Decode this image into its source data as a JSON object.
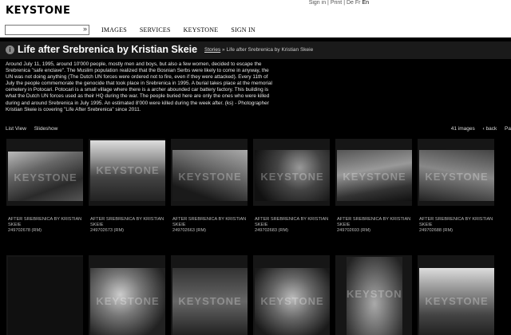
{
  "logo": "KEYSTONE",
  "toplinks": {
    "signin": "Sign in",
    "sep1": "|",
    "print": "Print",
    "sep2": "|",
    "de": "De",
    "fr": "Fr",
    "en": "En"
  },
  "search": {
    "placeholder": "",
    "go": "»"
  },
  "nav": [
    "IMAGES",
    "SERVICES",
    "KEYSTONE",
    "SIGN IN"
  ],
  "page_title": "Life after Srebrenica by Kristian Skeie",
  "breadcrumb": {
    "stories": "Stories",
    "rest": " » Life after Srebrenica by Kristian Skeie"
  },
  "description": "Around July 11, 1995, around 10'000 people, mostly men and boys, but also a few women, decided to escape the Srebrenica \"safe enclave\". The Muslim population realized that the Bosnian Serbs were likely to come in anyway, the UN was not doing anything (The Dutch UN forces were ordered not to fire, even if they were attacked). Every 11th of July the people commemorate the genocide that took place in Srebrenica in 1995. A burial takes place at the memorial cemetery in Potocari. Potocari is a small village where there is a archer abounded car battery factory. This building is what the Dutch UN forces used as their HQ during the war. The people buried here are only the ones who were killed during and around Srebrenica in July 1995. An estimated 8'000 were killed during the week after. (ks) - Photographer Kristian Skeie is covering \"Life After Srebrenica\" since 2011.",
  "views": {
    "list": "List View",
    "slideshow": "Slideshow"
  },
  "pager": {
    "count": "41 images",
    "back": "‹ back",
    "page": "Pa"
  },
  "watermark": "KEYSTONE",
  "thumbs": [
    {
      "title": "AFTER SREBRENICA BY KRISTIAN SKEIE",
      "id": "249702678 (RM)"
    },
    {
      "title": "AFTER SREBRENICA BY KRISTIAN SKEIE",
      "id": "249702673 (RM)"
    },
    {
      "title": "AFTER SREBRENICA BY KRISTIAN SKEIE",
      "id": "249702663 (RM)"
    },
    {
      "title": "AFTER SREBRENICA BY KRISTIAN SKEIE",
      "id": "249702683 (RM)"
    },
    {
      "title": "AFTER SREBRENICA BY KRISTIAN SKEIE",
      "id": "249702693 (RM)"
    },
    {
      "title": "AFTER SREBRENICA BY KRISTIAN SKEIE",
      "id": "249702688 (RM)"
    }
  ]
}
